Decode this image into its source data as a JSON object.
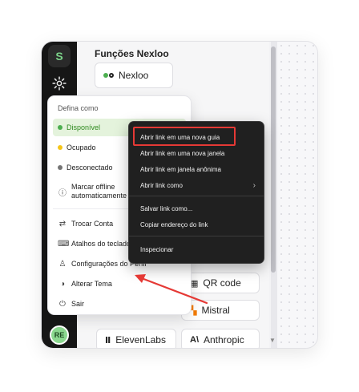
{
  "rail": {
    "logo_glyph": "S",
    "avatar_initials": "RE",
    "gear_icon": "gear-icon"
  },
  "panel": {
    "section_title": "Funções Nexloo",
    "nexloo_button": "Nexloo",
    "tools": [
      {
        "label": "QR code",
        "icon": "qr-icon"
      },
      {
        "label": "Mistral",
        "icon": "mistral-icon"
      },
      {
        "label": "ElevenLabs",
        "icon": "elevenlabs-icon"
      },
      {
        "label": "Anthropic",
        "icon": "anthropic-icon"
      }
    ]
  },
  "status_menu": {
    "caption": "Defina como",
    "statuses": [
      {
        "label": "Disponível",
        "color": "#4caf50"
      },
      {
        "label": "Ocupado",
        "color": "#f5c518"
      },
      {
        "label": "Desconectado",
        "color": "#757575"
      }
    ],
    "auto_offline": "Marcar offline automaticamente",
    "items": [
      {
        "label": "Trocar Conta",
        "icon": "switch-icon"
      },
      {
        "label": "Atalhos do teclado",
        "icon": "keyboard-icon"
      },
      {
        "label": "Configurações do Perfil",
        "icon": "user-icon"
      },
      {
        "label": "Alterar Tema",
        "icon": "theme-icon"
      },
      {
        "label": "Sair",
        "icon": "power-icon"
      }
    ]
  },
  "context_menu": {
    "items": [
      "Abrir link em uma nova guia",
      "Abrir link em uma nova janela",
      "Abrir link em janela anônima",
      "Abrir link como",
      "Salvar link como...",
      "Copiar endereço do link",
      "Inspecionar"
    ],
    "highlight_color": "#e53935"
  }
}
